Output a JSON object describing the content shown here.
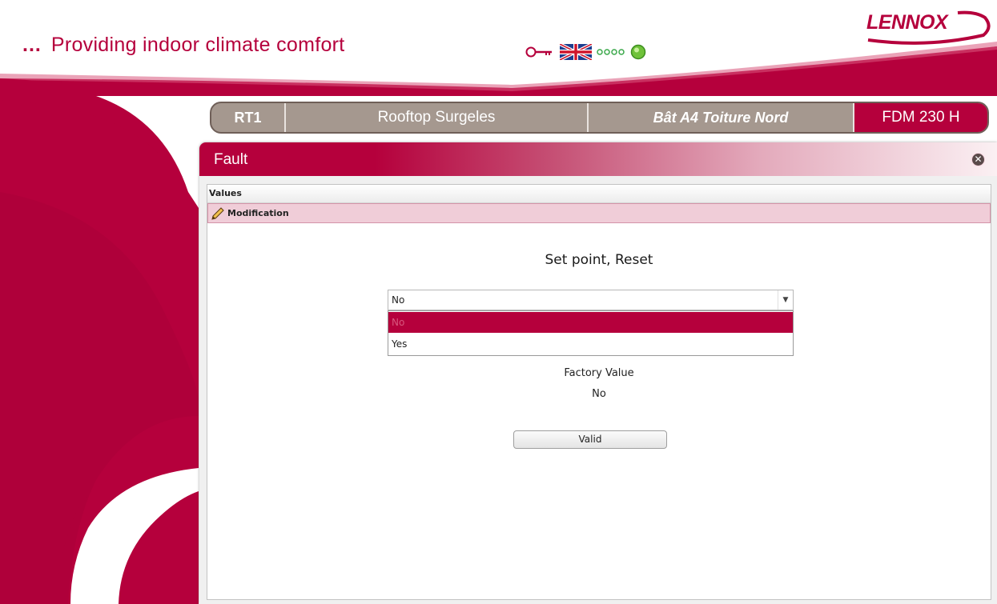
{
  "header": {
    "tagline_dots": "...",
    "tagline": "Providing indoor climate comfort",
    "logo_text": "LENNOX"
  },
  "status_icons": [
    "key-icon",
    "uk-flag-icon",
    "signal-dots-icon",
    "status-led-icon"
  ],
  "colors": {
    "brand": "#b5003c",
    "unit_bar": "#a5988f",
    "status_led": "#6fc23a"
  },
  "unit_bar": {
    "id": "RT1",
    "name": "Rooftop Surgeles",
    "location": "Bât A4 Toiture Nord",
    "model": "FDM 230 H"
  },
  "panel": {
    "title": "Fault",
    "values_label": "Values",
    "modification_label": "Modification"
  },
  "param": {
    "title": "Set point, Reset",
    "selected_value": "No",
    "options": [
      "No",
      "Yes"
    ],
    "factory_label": "Factory Value",
    "factory_value": "No",
    "valid_label": "Valid"
  }
}
